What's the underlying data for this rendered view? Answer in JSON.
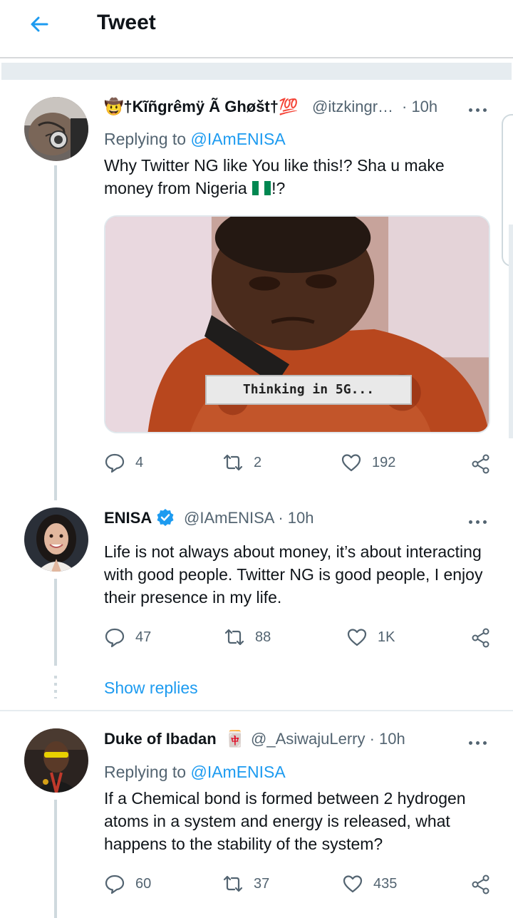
{
  "header": {
    "title": "Tweet",
    "back_icon": "arrow-left-icon"
  },
  "colors": {
    "accent": "#1d9bf0",
    "secondary_text": "#536471",
    "thread_line": "#cfd9de"
  },
  "tweets": [
    {
      "name": "🤠†Kĩñgrêmÿ Ã Ghøšt†💯",
      "handle": "@itzkingr…",
      "time": "· 10h",
      "replying_prefix": "Replying to",
      "replying_to": "@IAmENISA",
      "text_before_flag": "Why Twitter NG like You like this!? Sha u make money from Nigeria",
      "text_after_flag": "!?",
      "media_caption": "Thinking in 5G...",
      "stats": {
        "replies": "4",
        "retweets": "2",
        "likes": "192"
      }
    },
    {
      "name": "ENISA",
      "handle": "@IAmENISA · 10h",
      "verified": true,
      "text": "Life is not always about money, it’s about interacting with good people. Twitter NG is good people, I enjoy their presence in my life.",
      "stats": {
        "replies": "47",
        "retweets": "88",
        "likes": "1K"
      }
    },
    {
      "name": "Duke of Ibadan",
      "name_emoji": "🀄",
      "handle": "@_AsiwajuLerry · 10h",
      "replying_prefix": "Replying to",
      "replying_to": "@IAmENISA",
      "text": "If a Chemical bond is formed between 2 hydrogen atoms in a system and energy is released, what happens to the stability of the system?",
      "stats": {
        "replies": "60",
        "retweets": "37",
        "likes": "435"
      }
    }
  ],
  "show_replies": "Show replies"
}
